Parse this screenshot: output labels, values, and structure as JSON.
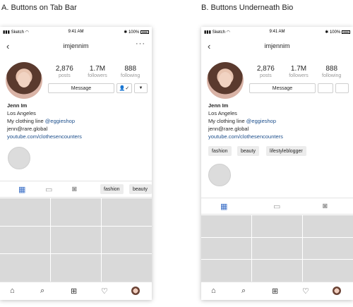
{
  "panelA": {
    "title": "A. Buttons on Tab Bar",
    "status": {
      "carrier": "Sketch",
      "time": "9:41 AM",
      "battery": "100%"
    },
    "username": "imjennim",
    "stats": [
      {
        "num": "2,876",
        "label": "posts"
      },
      {
        "num": "1.7M",
        "label": "followers"
      },
      {
        "num": "888",
        "label": "following"
      }
    ],
    "message_label": "Message",
    "bio": {
      "name": "Jenn Im",
      "location": "Los Angeles",
      "line_prefix": "My clothing line ",
      "mention": "@eggieshop",
      "email": "jenn@rare.global",
      "link": "youtube.com/clothesencounters"
    },
    "chips": [
      "fashion",
      "beauty"
    ]
  },
  "panelB": {
    "title": "B. Buttons Underneath Bio",
    "status": {
      "carrier": "Sketch",
      "time": "9:41 AM",
      "battery": "100%"
    },
    "username": "imjennim",
    "stats": [
      {
        "num": "2,876",
        "label": "posts"
      },
      {
        "num": "1.7M",
        "label": "followers"
      },
      {
        "num": "888",
        "label": "following"
      }
    ],
    "message_label": "Message",
    "bio": {
      "name": "Jenn Im",
      "location": "Los Angeles",
      "line_prefix": "My clothing line ",
      "mention": "@eggieshop",
      "email": "jenn@rare.global",
      "link": "youtube.com/clothesencounters"
    },
    "chips": [
      "fashion",
      "beauty",
      "lifestyleblogger"
    ]
  },
  "icons": {
    "back": "chevron-left-icon",
    "more": "more-icon",
    "grid": "grid-icon",
    "igtv": "tv-icon",
    "tagged": "tagged-icon",
    "home": "home-icon",
    "search": "search-icon",
    "add": "add-icon",
    "heart": "heart-icon"
  },
  "colors": {
    "accent": "#3b6fc7",
    "link": "#1d4f8c",
    "placeholder": "#d9d9d9"
  }
}
